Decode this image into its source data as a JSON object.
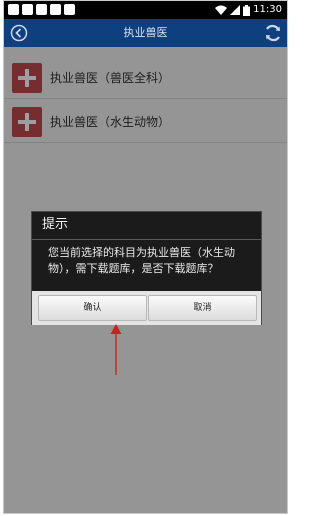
{
  "status_bar": {
    "time": "11:30"
  },
  "header": {
    "title": "执业兽医"
  },
  "list": {
    "items": [
      {
        "label": "执业兽医（兽医全科）"
      },
      {
        "label": "执业兽医（水生动物）"
      }
    ]
  },
  "dialog": {
    "title": "提示",
    "message": "您当前选择的科目为执业兽医（水生动物），需下载题库，是否下载题库？",
    "confirm_label": "确认",
    "cancel_label": "取消"
  },
  "colors": {
    "header_bg": "#0e3f7f",
    "plus_icon_bg": "#bd4a4e",
    "annotation_arrow": "#cc1f1f"
  },
  "icons": {
    "back": "back-circle-icon",
    "refresh": "refresh-icon",
    "add": "plus-icon",
    "wifi": "wifi-icon",
    "signal": "signal-icon",
    "battery": "battery-icon"
  }
}
